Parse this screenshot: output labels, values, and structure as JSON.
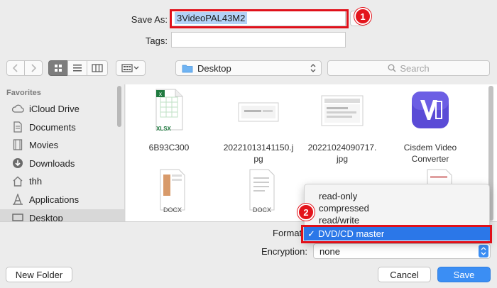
{
  "save_as": {
    "label": "Save As:",
    "value": "3VideoPAL43M2"
  },
  "tags": {
    "label": "Tags:",
    "value": ""
  },
  "toolbar": {
    "location": "Desktop",
    "search_placeholder": "Search"
  },
  "sidebar": {
    "heading": "Favorites",
    "items": [
      {
        "label": "iCloud Drive",
        "icon": "cloud-icon"
      },
      {
        "label": "Documents",
        "icon": "documents-icon"
      },
      {
        "label": "Movies",
        "icon": "film-icon"
      },
      {
        "label": "Downloads",
        "icon": "download-icon"
      },
      {
        "label": "thh",
        "icon": "home-icon"
      },
      {
        "label": "Applications",
        "icon": "applications-icon"
      },
      {
        "label": "Desktop",
        "icon": "desktop-icon"
      }
    ]
  },
  "files": [
    {
      "name": "6B93C300",
      "type": "xlsx",
      "badge": "XLSX"
    },
    {
      "name": "20221013141150.j\npg",
      "type": "jpg"
    },
    {
      "name": "20221024090717.\njpg",
      "type": "jpg"
    },
    {
      "name": "Cisdem Video\nConverter",
      "type": "app"
    },
    {
      "name": "",
      "type": "docx",
      "badge": "DOCX"
    },
    {
      "name": "",
      "type": "docx",
      "badge": "DOCX"
    }
  ],
  "format": {
    "label": "Format",
    "options": [
      "read-only",
      "compressed",
      "read/write",
      "DVD/CD master"
    ],
    "selected": "DVD/CD master",
    "check": "✓"
  },
  "encryption": {
    "label": "Encryption:",
    "value": "none"
  },
  "buttons": {
    "new_folder": "New Folder",
    "cancel": "Cancel",
    "save": "Save"
  },
  "badges": {
    "one": "1",
    "two": "2"
  },
  "colors": {
    "accent": "#3b8ef4",
    "annotation": "#e0101a",
    "highlight": "#2b77e8"
  }
}
